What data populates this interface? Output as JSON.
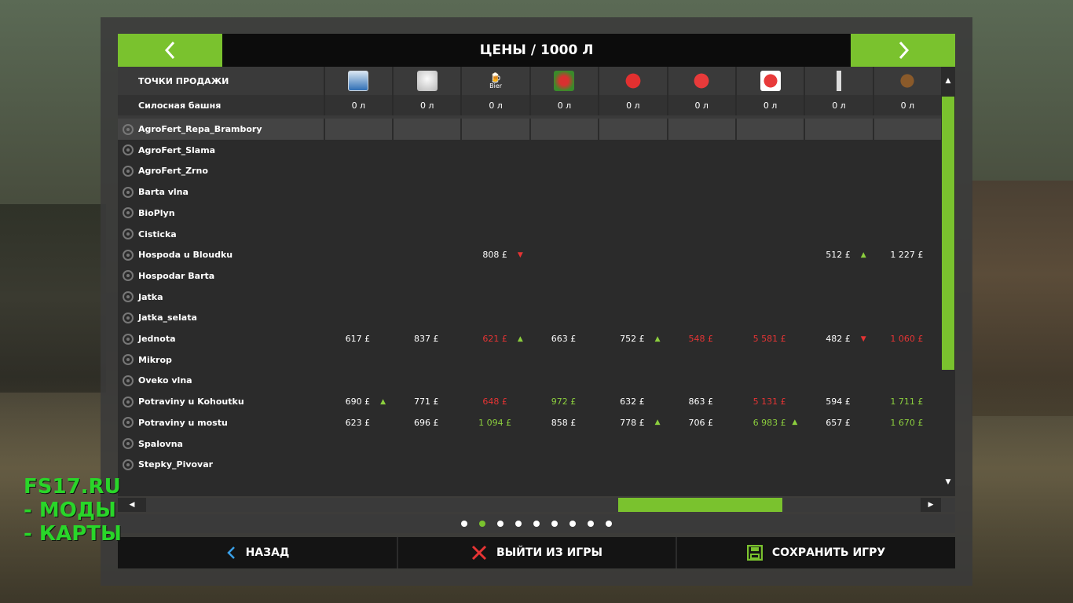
{
  "header": {
    "title": "ЦЕНЫ / 1000 Л"
  },
  "table": {
    "name_header": "ТОЧКИ ПРОДАЖИ",
    "columns": [
      {
        "icon": "milk-can-icon",
        "label": ""
      },
      {
        "icon": "wool-icon",
        "label": ""
      },
      {
        "icon": "beer-icon",
        "label": "Bier"
      },
      {
        "icon": "vegetable-icon",
        "label": ""
      },
      {
        "icon": "strawberry-icon",
        "label": ""
      },
      {
        "icon": "strawberry-icon-2",
        "label": ""
      },
      {
        "icon": "strawberry-icon-3",
        "label": ""
      },
      {
        "icon": "bottle-icon",
        "label": ""
      },
      {
        "icon": "barrel-icon",
        "label": ""
      }
    ],
    "silo": {
      "name": "Силосная башня",
      "values": [
        "0 л",
        "0 л",
        "0 л",
        "0 л",
        "0 л",
        "0 л",
        "0 л",
        "0 л",
        "0 л"
      ]
    },
    "rows": [
      {
        "name": "AgroFert_Repa_Brambory",
        "selected": true,
        "cells": []
      },
      {
        "name": "AgroFert_Slama",
        "cells": []
      },
      {
        "name": "AgroFert_Zrno",
        "cells": []
      },
      {
        "name": "Barta vlna",
        "cells": []
      },
      {
        "name": "BioPlyn",
        "cells": []
      },
      {
        "name": "Cisticka",
        "cells": []
      },
      {
        "name": "Hospoda u Bloudku",
        "cells": [
          {
            "v": ""
          },
          {
            "v": ""
          },
          {
            "v": "808 £",
            "t": "down"
          },
          {
            "v": ""
          },
          {
            "v": ""
          },
          {
            "v": ""
          },
          {
            "v": ""
          },
          {
            "v": "512 £",
            "t": "up"
          },
          {
            "v": "1 227 £"
          }
        ]
      },
      {
        "name": "Hospodar Barta",
        "cells": []
      },
      {
        "name": "Jatka",
        "cells": []
      },
      {
        "name": "Jatka_selata",
        "cells": []
      },
      {
        "name": "Jednota",
        "cells": [
          {
            "v": "617 £"
          },
          {
            "v": "837 £"
          },
          {
            "v": "621 £",
            "c": "red",
            "t": "up"
          },
          {
            "v": "663 £"
          },
          {
            "v": "752 £",
            "t": "up"
          },
          {
            "v": "548 £",
            "c": "red"
          },
          {
            "v": "5 581 £",
            "c": "red"
          },
          {
            "v": "482 £",
            "t": "down"
          },
          {
            "v": "1 060 £",
            "c": "red"
          }
        ]
      },
      {
        "name": "Mikrop",
        "cells": []
      },
      {
        "name": "Oveko vlna",
        "cells": []
      },
      {
        "name": "Potraviny u Kohoutku",
        "cells": [
          {
            "v": "690 £",
            "t": "up"
          },
          {
            "v": "771 £"
          },
          {
            "v": "648 £",
            "c": "red"
          },
          {
            "v": "972 £",
            "c": "green"
          },
          {
            "v": "632 £"
          },
          {
            "v": "863 £"
          },
          {
            "v": "5 131 £",
            "c": "red"
          },
          {
            "v": "594 £"
          },
          {
            "v": "1 711 £",
            "c": "green"
          }
        ]
      },
      {
        "name": "Potraviny u mostu",
        "cells": [
          {
            "v": "623 £"
          },
          {
            "v": "696 £"
          },
          {
            "v": "1 094 £",
            "c": "green"
          },
          {
            "v": "858 £"
          },
          {
            "v": "778 £",
            "t": "up"
          },
          {
            "v": "706 £"
          },
          {
            "v": "6 983 £",
            "c": "green",
            "t": "up"
          },
          {
            "v": "657 £"
          },
          {
            "v": "1 670 £",
            "c": "green"
          }
        ]
      },
      {
        "name": "Spalovna",
        "cells": []
      },
      {
        "name": "Stepky_Pivovar",
        "cells": []
      }
    ]
  },
  "pager": {
    "count": 9,
    "active": 1
  },
  "footer": {
    "back_label": "НАЗАД",
    "quit_label": "ВЫЙТИ ИЗ ИГРЫ",
    "save_label": "СОХРАНИТЬ ИГРУ"
  },
  "watermark": {
    "line1": "FS17.RU",
    "line2": "- МОДЫ",
    "line3": "- КАРТЫ"
  },
  "colors": {
    "accent": "#7ac22e",
    "price_up": "#8ccf3e",
    "price_down": "#e63434"
  }
}
